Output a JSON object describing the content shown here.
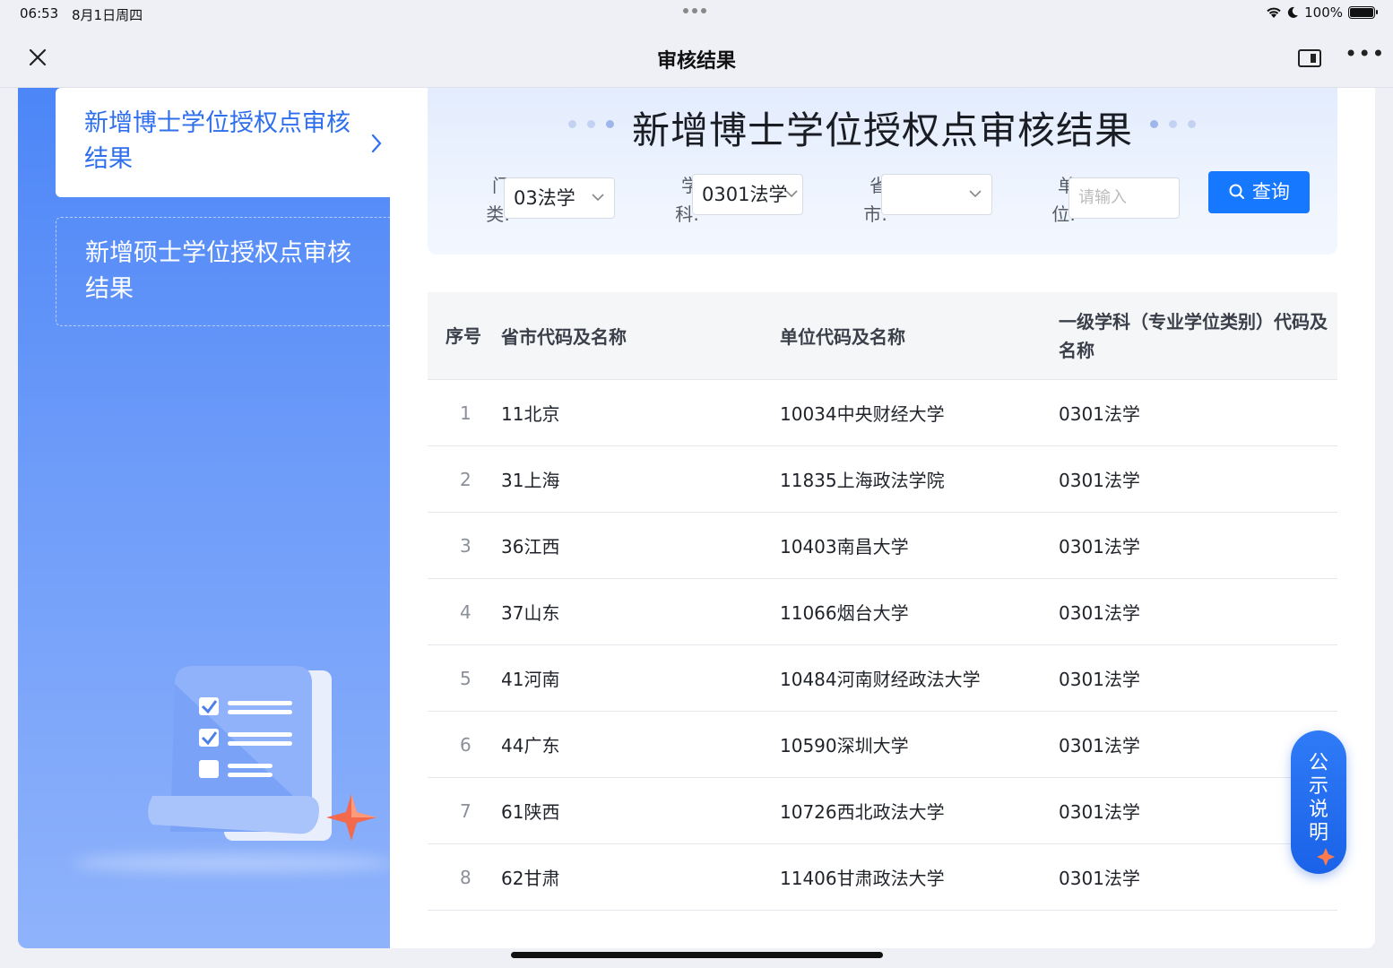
{
  "status_bar": {
    "time": "06:53",
    "date": "8月1日周四",
    "battery": "100%"
  },
  "nav": {
    "title": "审核结果"
  },
  "sidebar": {
    "items": [
      {
        "label": "新增博士学位授权点审核结果",
        "active": true
      },
      {
        "label": "新增硕士学位授权点审核结果",
        "active": false
      }
    ]
  },
  "panel": {
    "title": "新增博士学位授权点审核结果",
    "filters": {
      "category_label_1": "门",
      "category_label_2": "类:",
      "category_value": "03法学",
      "subject_label_1": "学",
      "subject_label_2": "科:",
      "subject_value": "0301法学",
      "province_label_1": "省",
      "province_label_2": "市:",
      "province_value": "",
      "unit_label_1": "单",
      "unit_label_2": "位:",
      "unit_placeholder": "请输入"
    },
    "query_button": "查询"
  },
  "table": {
    "headers": [
      "序号",
      "省市代码及名称",
      "单位代码及名称",
      "一级学科（专业学位类别）代码及名称"
    ],
    "rows": [
      {
        "no": "1",
        "province": "11北京",
        "unit": "10034中央财经大学",
        "subject": "0301法学"
      },
      {
        "no": "2",
        "province": "31上海",
        "unit": "11835上海政法学院",
        "subject": "0301法学"
      },
      {
        "no": "3",
        "province": "36江西",
        "unit": "10403南昌大学",
        "subject": "0301法学"
      },
      {
        "no": "4",
        "province": "37山东",
        "unit": "11066烟台大学",
        "subject": "0301法学"
      },
      {
        "no": "5",
        "province": "41河南",
        "unit": "10484河南财经政法大学",
        "subject": "0301法学"
      },
      {
        "no": "6",
        "province": "44广东",
        "unit": "10590深圳大学",
        "subject": "0301法学"
      },
      {
        "no": "7",
        "province": "61陕西",
        "unit": "10726西北政法大学",
        "subject": "0301法学"
      },
      {
        "no": "8",
        "province": "62甘肃",
        "unit": "11406甘肃政法大学",
        "subject": "0301法学"
      }
    ]
  },
  "floating": {
    "notice_label": "公示说明"
  },
  "icons": [
    "close-icon",
    "split-view-icon",
    "more-icon",
    "chevron-right-icon",
    "chevron-down-icon",
    "search-icon",
    "wifi-icon",
    "moon-icon",
    "battery-icon"
  ],
  "colors": {
    "accent": "#1677ff",
    "sidebar_top": "#4c86f7",
    "sidebar_bottom": "#8fb3fb",
    "active_text": "#2f6fed"
  }
}
